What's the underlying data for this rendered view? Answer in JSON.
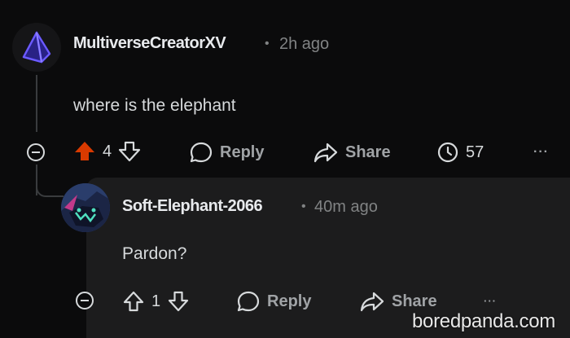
{
  "comment": {
    "username": "MultiverseCreatorXV",
    "separator": "•",
    "time": "2h ago",
    "body": "where is the elephant",
    "votes": "4",
    "reply_label": "Reply",
    "share_label": "Share",
    "award_count": "57",
    "more_label": "···"
  },
  "reply": {
    "username": "Soft-Elephant-2066",
    "separator": "•",
    "time": "40m ago",
    "body": "Pardon?",
    "votes": "1",
    "reply_label": "Reply",
    "share_label": "Share",
    "more_label": "···"
  },
  "watermark": "boredpanda.com",
  "colors": {
    "background": "#0b0b0c",
    "reply_card": "#1c1c1d",
    "upvote_active": "#d93a00",
    "text_muted": "#818384"
  }
}
